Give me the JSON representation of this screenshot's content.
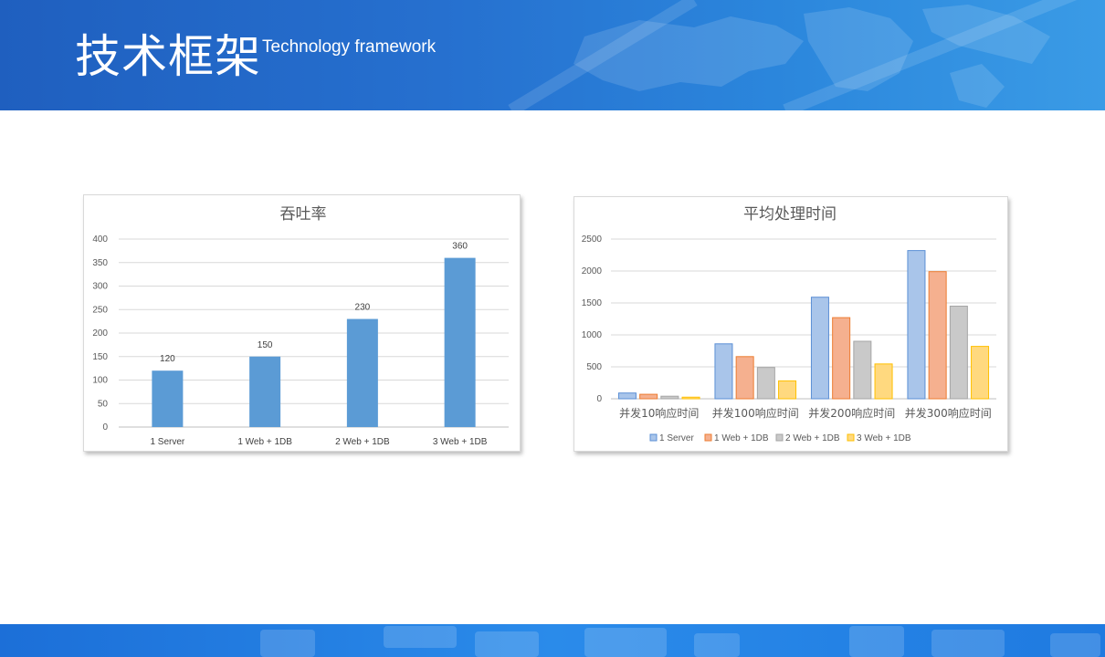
{
  "header": {
    "title": "技术框架",
    "subtitle": "Technology framework"
  },
  "colors": {
    "bar_primary": "#5b9bd5",
    "series": [
      "#a9c5ea",
      "#f5b08f",
      "#c9c9c9",
      "#ffd97f"
    ],
    "series_stroke": [
      "#5b8fd5",
      "#ed7d31",
      "#a5a5a5",
      "#ffc000"
    ]
  },
  "chart_data": [
    {
      "type": "bar",
      "title": "吞吐率",
      "categories": [
        "1 Server",
        "1 Web + 1DB",
        "2 Web + 1DB",
        "3 Web + 1DB"
      ],
      "values": [
        120,
        150,
        230,
        360
      ],
      "data_labels": [
        "120",
        "150",
        "230",
        "360"
      ],
      "ylim": [
        0,
        400
      ],
      "yticks": [
        "0",
        "50",
        "100",
        "150",
        "200",
        "250",
        "300",
        "350",
        "400"
      ],
      "grid": true,
      "legend": "none"
    },
    {
      "type": "bar",
      "title": "平均处理时间",
      "categories": [
        "并发10响应时间",
        "并发100响应时间",
        "并发200响应时间",
        "并发300响应时间"
      ],
      "series": [
        {
          "name": "1 Server",
          "values": [
            90,
            860,
            1590,
            2320
          ]
        },
        {
          "name": "1 Web + 1DB",
          "values": [
            70,
            660,
            1270,
            1990
          ]
        },
        {
          "name": "2 Web + 1DB",
          "values": [
            40,
            490,
            900,
            1450
          ]
        },
        {
          "name": "3 Web + 1DB",
          "values": [
            25,
            280,
            545,
            820
          ]
        }
      ],
      "ylim": [
        0,
        2500
      ],
      "yticks": [
        "0",
        "500",
        "1000",
        "1500",
        "2000",
        "2500"
      ],
      "grid": true,
      "legend": "bottom"
    }
  ]
}
